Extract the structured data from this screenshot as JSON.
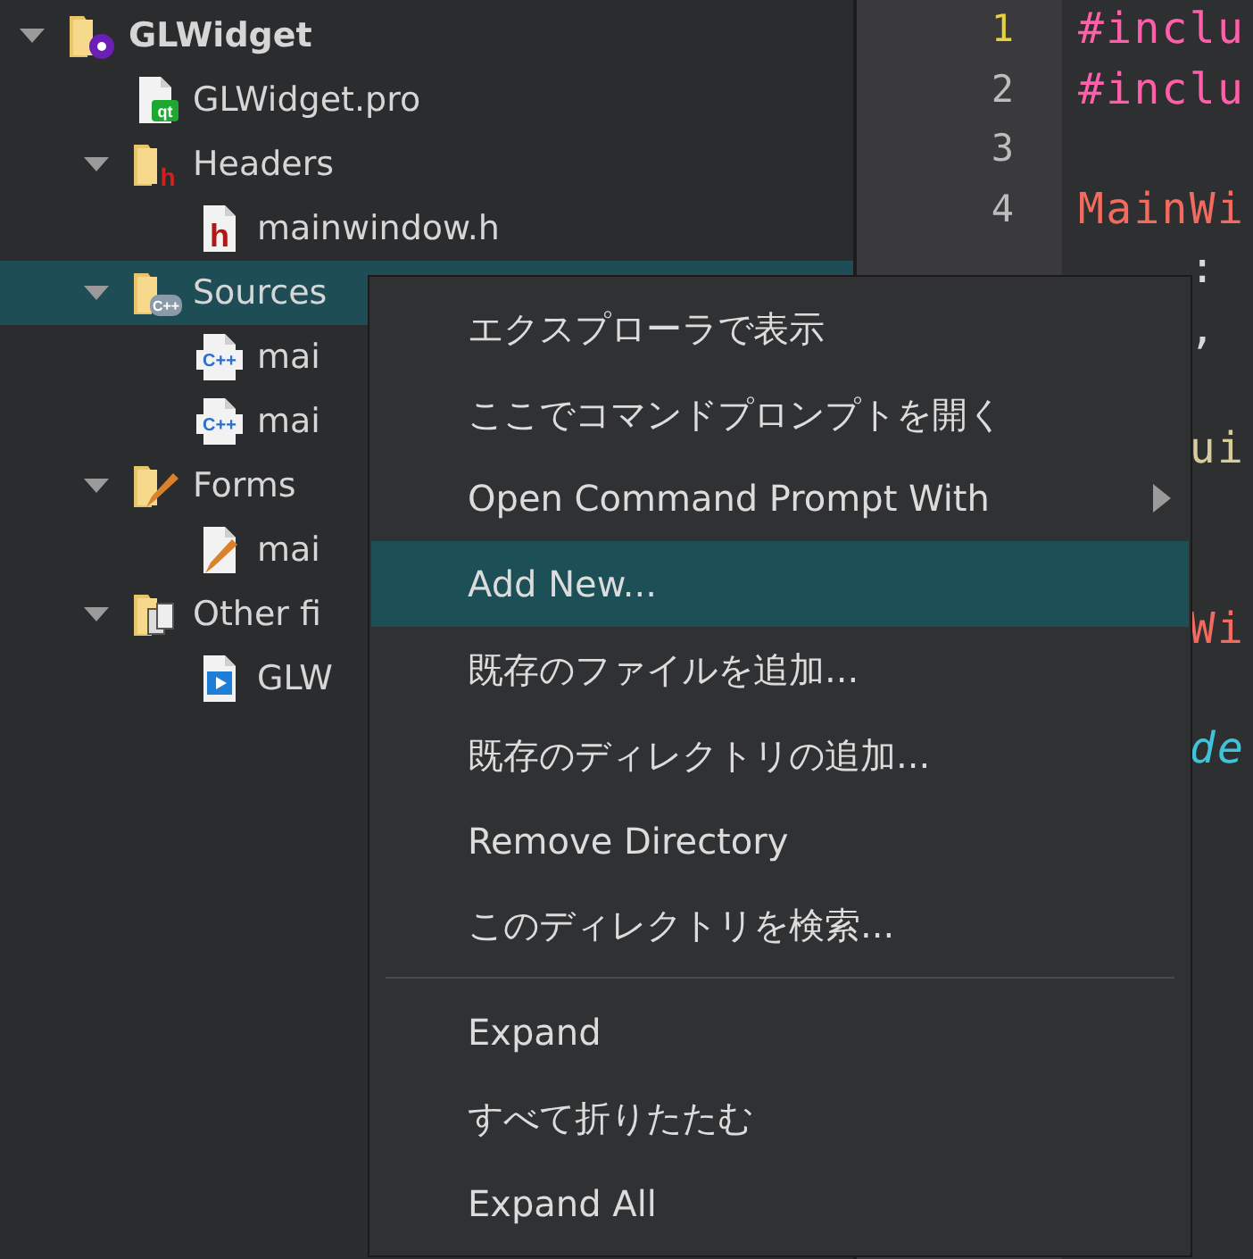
{
  "tree": [
    {
      "label": "GLWidget",
      "kind": "project",
      "bold": true,
      "expanded": true,
      "selected": false,
      "children": [
        {
          "label": "GLWidget.pro",
          "kind": "qt-file",
          "badge": "qt",
          "selected": false
        },
        {
          "label": "Headers",
          "kind": "header-folder",
          "badge": "h",
          "expanded": true,
          "selected": false,
          "children": [
            {
              "label": "mainwindow.h",
              "kind": "header-file",
              "badge": "h",
              "selected": false
            }
          ]
        },
        {
          "label": "Sources",
          "kind": "source-folder",
          "badge": "C++",
          "expanded": true,
          "selected": true,
          "children": [
            {
              "label": "mai",
              "kind": "source-file",
              "badge": "C++",
              "selected": false
            },
            {
              "label": "mai",
              "kind": "source-file",
              "badge": "C++",
              "selected": false
            }
          ]
        },
        {
          "label": "Forms",
          "kind": "form-folder",
          "expanded": true,
          "selected": false,
          "children": [
            {
              "label": "mai",
              "kind": "form-file",
              "selected": false
            }
          ]
        },
        {
          "label": "Other fi",
          "kind": "other-folder",
          "expanded": true,
          "selected": false,
          "children": [
            {
              "label": "GLW",
              "kind": "media-file",
              "selected": false
            }
          ]
        }
      ]
    }
  ],
  "editor": {
    "line_numbers": [
      {
        "number": "1",
        "current": true
      },
      {
        "number": "2",
        "current": false
      },
      {
        "number": "3",
        "current": false
      },
      {
        "number": "4",
        "current": false
      }
    ],
    "lines": [
      {
        "text": "#inclu",
        "kind": "directive"
      },
      {
        "text": "#inclu",
        "kind": "directive"
      },
      {
        "kind": "blank"
      },
      {
        "text": "MainWi",
        "kind": "type"
      },
      {
        "text": "    :",
        "kind": "plain"
      },
      {
        "text": "    ,",
        "kind": "plain"
      },
      {
        "kind": "blank"
      },
      {
        "text": "    ui",
        "kind": "member"
      },
      {
        "kind": "blank"
      },
      {
        "kind": "blank"
      },
      {
        "text": "    Wi",
        "kind": "type"
      },
      {
        "kind": "blank"
      },
      {
        "text": "    de",
        "kind": "keyword"
      }
    ]
  },
  "context_menu": [
    {
      "kind": "item",
      "label": "エクスプローラで表示",
      "selected": false,
      "submenu": false
    },
    {
      "kind": "item",
      "label": "ここでコマンドプロンプトを開く",
      "selected": false,
      "submenu": false
    },
    {
      "kind": "item",
      "label": "Open Command Prompt With",
      "selected": false,
      "submenu": true
    },
    {
      "kind": "item",
      "label": "Add New...",
      "selected": true,
      "submenu": false
    },
    {
      "kind": "item",
      "label": "既存のファイルを追加...",
      "selected": false,
      "submenu": false
    },
    {
      "kind": "item",
      "label": "既存のディレクトリの追加...",
      "selected": false,
      "submenu": false
    },
    {
      "kind": "item",
      "label": "Remove Directory",
      "selected": false,
      "submenu": false
    },
    {
      "kind": "item",
      "label": "このディレクトリを検索...",
      "selected": false,
      "submenu": false
    },
    {
      "kind": "separator"
    },
    {
      "kind": "item",
      "label": "Expand",
      "selected": false,
      "submenu": false
    },
    {
      "kind": "item",
      "label": "すべて折りたたむ",
      "selected": false,
      "submenu": false
    },
    {
      "kind": "item",
      "label": "Expand All",
      "selected": false,
      "submenu": false
    }
  ]
}
